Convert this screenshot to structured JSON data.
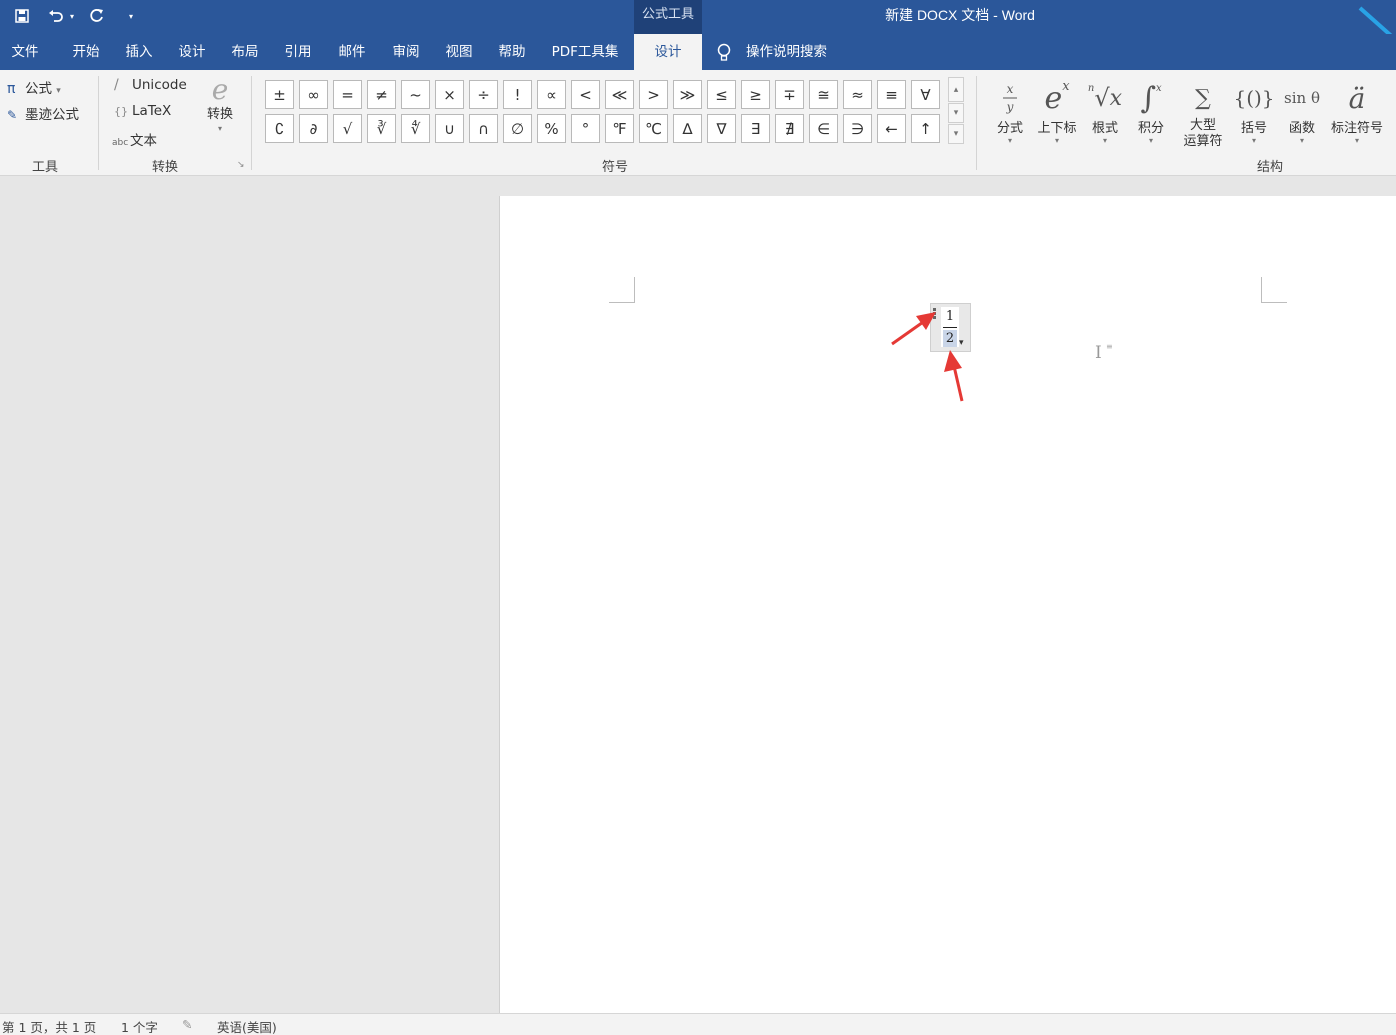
{
  "window": {
    "title": "新建 DOCX 文档  -  Word",
    "context_group": "公式工具",
    "quick_access": [
      "save-icon",
      "undo-icon",
      "redo-icon",
      "customize-icon"
    ]
  },
  "tabs": [
    {
      "label": "文件"
    },
    {
      "label": "开始"
    },
    {
      "label": "插入"
    },
    {
      "label": "设计"
    },
    {
      "label": "布局"
    },
    {
      "label": "引用"
    },
    {
      "label": "邮件"
    },
    {
      "label": "审阅"
    },
    {
      "label": "视图"
    },
    {
      "label": "帮助"
    },
    {
      "label": "PDF工具集"
    },
    {
      "label": "设计",
      "active": true
    }
  ],
  "tell_me": "操作说明搜索",
  "ribbon": {
    "tools": {
      "equation": "公式",
      "ink_equation": "墨迹公式",
      "label": "工具"
    },
    "conversions": {
      "unicode": "Unicode",
      "latex": "LaTeX",
      "text": "文本",
      "convert": "转换",
      "label": "转换"
    },
    "symbols": {
      "row1": [
        "±",
        "∞",
        "=",
        "≠",
        "~",
        "×",
        "÷",
        "!",
        "∝",
        "<",
        "≪",
        ">",
        "≫",
        "≤",
        "≥",
        "∓",
        "≅",
        "≈",
        "≡",
        "∀"
      ],
      "row2": [
        "∁",
        "∂",
        "√",
        "∛",
        "∜",
        "∪",
        "∩",
        "∅",
        "%",
        "°",
        "℉",
        "℃",
        "∆",
        "∇",
        "∃",
        "∄",
        "∈",
        "∋",
        "←",
        "↑"
      ],
      "label": "符号"
    },
    "structures": {
      "items": [
        {
          "label": "分式",
          "glyph": "x/y"
        },
        {
          "label": "上下标",
          "glyph": "eˣ"
        },
        {
          "label": "根式",
          "glyph": "ⁿ√x"
        },
        {
          "label": "积分",
          "glyph": "∫"
        },
        {
          "label": "大型\n运算符",
          "glyph": "∑"
        },
        {
          "label": "括号",
          "glyph": "{()}"
        },
        {
          "label": "函数",
          "glyph": "sin θ"
        },
        {
          "label": "标注符号",
          "glyph": "ä"
        }
      ],
      "label": "结构"
    }
  },
  "document": {
    "equation": {
      "numerator": "1",
      "denominator": "2"
    }
  },
  "status": {
    "page": "第 1 页，共 1 页",
    "words": "1 个字",
    "language": "英语(美国)"
  },
  "colors": {
    "title_bar": "#2b579a",
    "ribbon": "#f3f3f3",
    "canvas": "#e6e6e6",
    "arrow": "#e53935"
  }
}
